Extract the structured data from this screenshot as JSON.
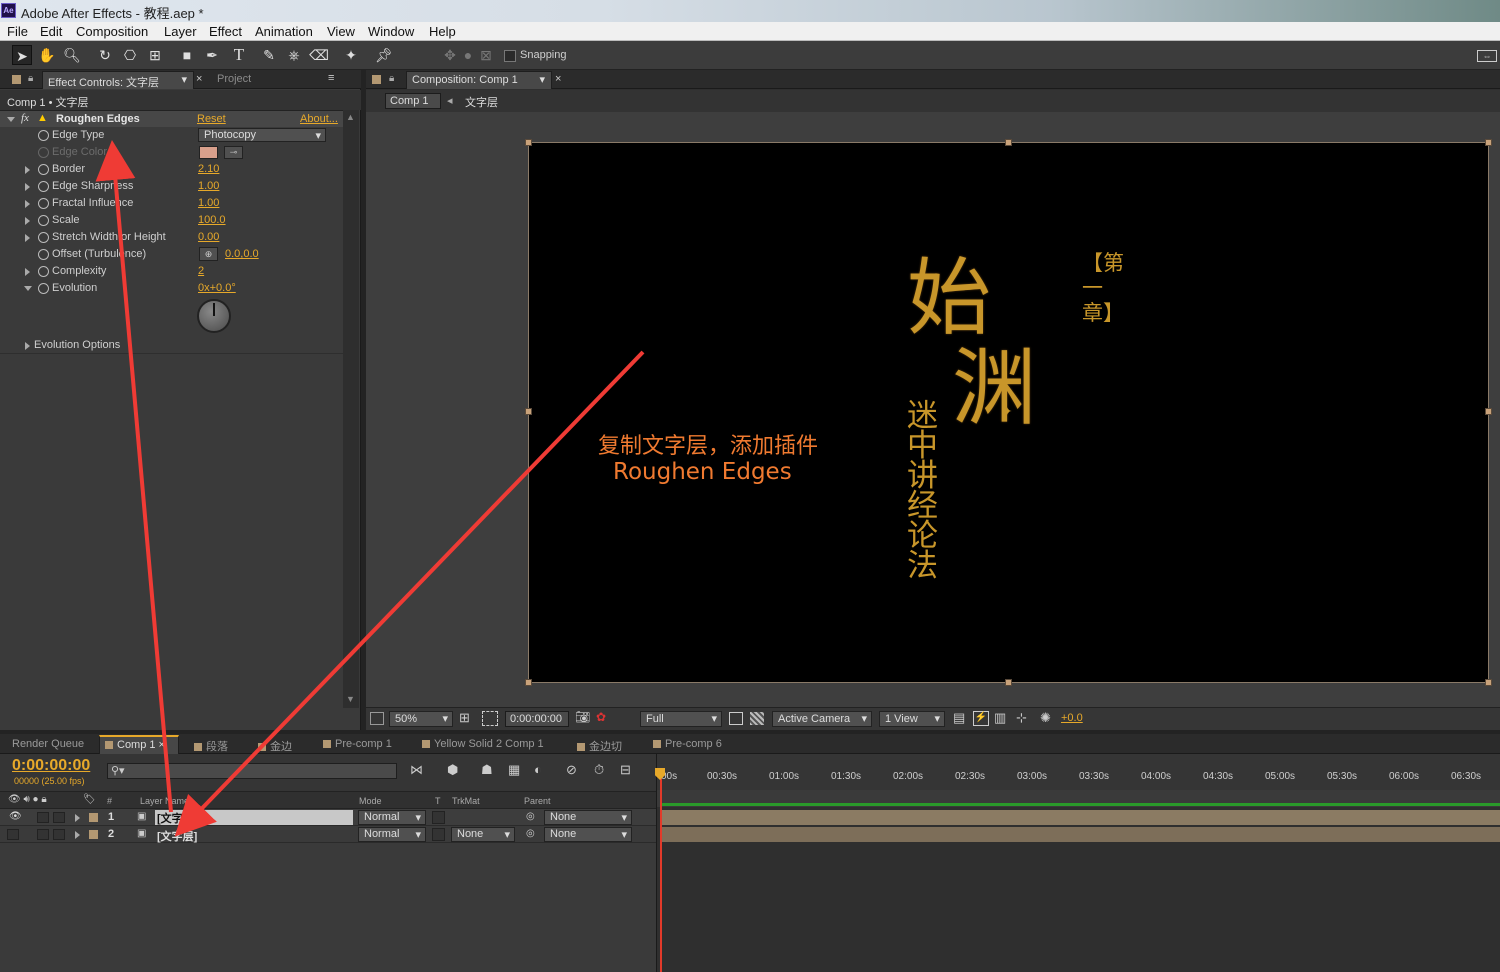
{
  "window": {
    "title": "Adobe After Effects - 教程.aep *",
    "app_icon": "Ae"
  },
  "menu": [
    "File",
    "Edit",
    "Composition",
    "Layer",
    "Effect",
    "Animation",
    "View",
    "Window",
    "Help"
  ],
  "toolbar": {
    "snapping_label": "Snapping"
  },
  "effect_panel": {
    "tab_label": "Effect Controls: 文字层",
    "project_tab": "Project",
    "breadcrumb": "Comp 1 • 文字层",
    "effect_name": "Roughen Edges",
    "reset": "Reset",
    "about": "About...",
    "properties": [
      {
        "label": "Edge Type",
        "value": "Photocopy"
      },
      {
        "label": "Edge Color",
        "value": ""
      },
      {
        "label": "Border",
        "value": "2.10"
      },
      {
        "label": "Edge Sharpness",
        "value": "1.00"
      },
      {
        "label": "Fractal Influence",
        "value": "1.00"
      },
      {
        "label": "Scale",
        "value": "100.0"
      },
      {
        "label": "Stretch Width or Height",
        "value": "0.00"
      },
      {
        "label": "Offset (Turbulence)",
        "value": "0.0,0.0"
      },
      {
        "label": "Complexity",
        "value": "2"
      },
      {
        "label": "Evolution",
        "value": "0x+0.0°"
      }
    ],
    "evolution_options": "Evolution Options",
    "edge_color_hex": "#d9a08c"
  },
  "comp_panel": {
    "tab_label": "Composition: Comp 1",
    "crumb_comp": "Comp 1",
    "crumb_layer": "文字层",
    "artwork": {
      "big1": "始",
      "big2": "渊",
      "side": "【第一章】",
      "vertical": "迷中讲经论法"
    },
    "annotation_line1": "复制文字层，添加插件",
    "annotation_line2": "Roughen Edges",
    "footer": {
      "zoom": "50%",
      "timecode": "0:00:00:00",
      "resolution": "Full",
      "camera": "Active Camera",
      "views": "1 View",
      "exposure": "+0.0"
    }
  },
  "timeline": {
    "tabs": [
      "Render Queue",
      "Comp 1",
      "段落",
      "金边",
      "Pre-comp 1",
      "Yellow Solid 2 Comp 1",
      "金边切",
      "Pre-comp 6"
    ],
    "timecode": "0:00:00:00",
    "fps": "00000 (25.00 fps)",
    "columns": {
      "num": "#",
      "name": "Layer Name",
      "mode": "Mode",
      "t": "T",
      "trkmat": "TrkMat",
      "parent": "Parent"
    },
    "ruler": [
      "00s",
      "00:30s",
      "01:00s",
      "01:30s",
      "02:00s",
      "02:30s",
      "03:00s",
      "03:30s",
      "04:00s",
      "04:30s",
      "05:00s",
      "05:30s",
      "06:00s",
      "06:30s"
    ],
    "layers": [
      {
        "num": "1",
        "name": "[文字层]",
        "mode": "Normal",
        "trkmat": "",
        "parent": "None"
      },
      {
        "num": "2",
        "name": "[文字层]",
        "mode": "Normal",
        "trkmat": "None",
        "parent": "None"
      }
    ]
  },
  "colors": {
    "accent": "#e7a92a",
    "annotation": "#f07a30",
    "arrow": "#ef3b35"
  }
}
